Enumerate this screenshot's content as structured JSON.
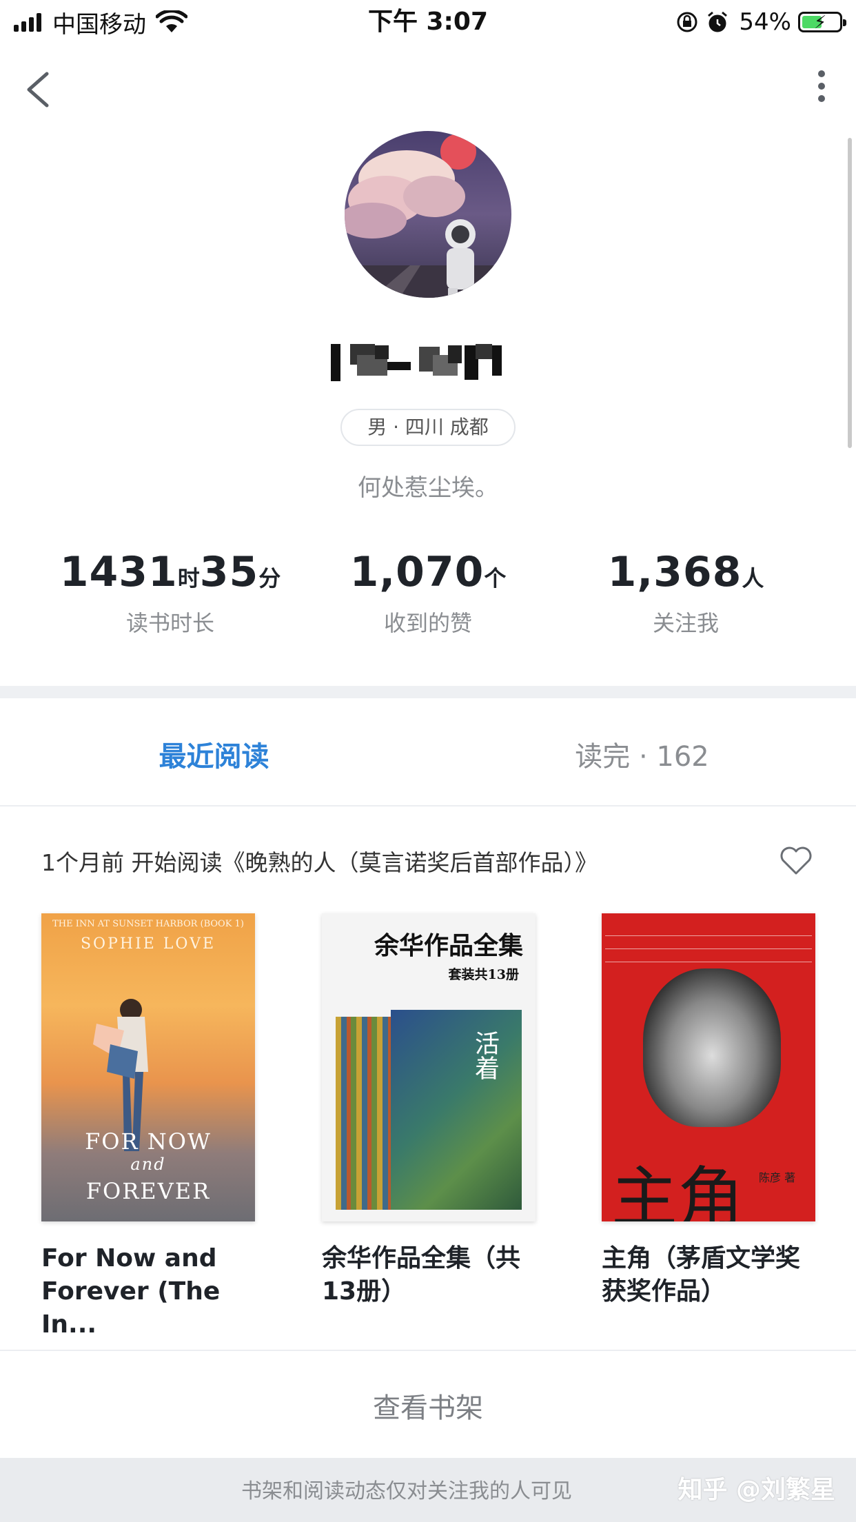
{
  "status_bar": {
    "carrier": "中国移动",
    "time": "下午 3:07",
    "battery_percent": "54%"
  },
  "profile": {
    "tag": "男 · 四川 成都",
    "motto": "何处惹尘埃。"
  },
  "stats": [
    {
      "value_a": "1431",
      "unit_a": "时",
      "value_b": "35",
      "unit_b": "分",
      "label": "读书时长"
    },
    {
      "value": "1,070",
      "unit": "个",
      "label": "收到的赞"
    },
    {
      "value": "1,368",
      "unit": "人",
      "label": "关注我"
    }
  ],
  "tabs": {
    "recent": "最近阅读",
    "finished": "读完 · 162"
  },
  "activity": {
    "text": "1个月前 开始阅读《晚熟的人（莫言诺奖后首部作品）》"
  },
  "books": [
    {
      "title": "For Now and Forever (The In...",
      "cover_series": "THE INN AT SUNSET HARBOR (BOOK 1)",
      "cover_author": "SOPHIE LOVE",
      "cover_title_1": "FOR NOW",
      "cover_title_2": "and",
      "cover_title_3": "FOREVER"
    },
    {
      "title": "余华作品全集（共13册）",
      "cover_title": "余华作品全集",
      "cover_subtitle": "套装共13册",
      "cover_inner": "活着"
    },
    {
      "title": "主角（茅盾文学奖获奖作品）",
      "cover_title": "主角",
      "cover_author": "陈彦 著"
    }
  ],
  "shelf_link": "查看书架",
  "footer_note": "书架和阅读动态仅对关注我的人可见",
  "watermark": "知乎 @刘繁星",
  "colors": {
    "accent": "#2d82d8",
    "muted": "#8a8d91",
    "band": "#eef0f3"
  }
}
